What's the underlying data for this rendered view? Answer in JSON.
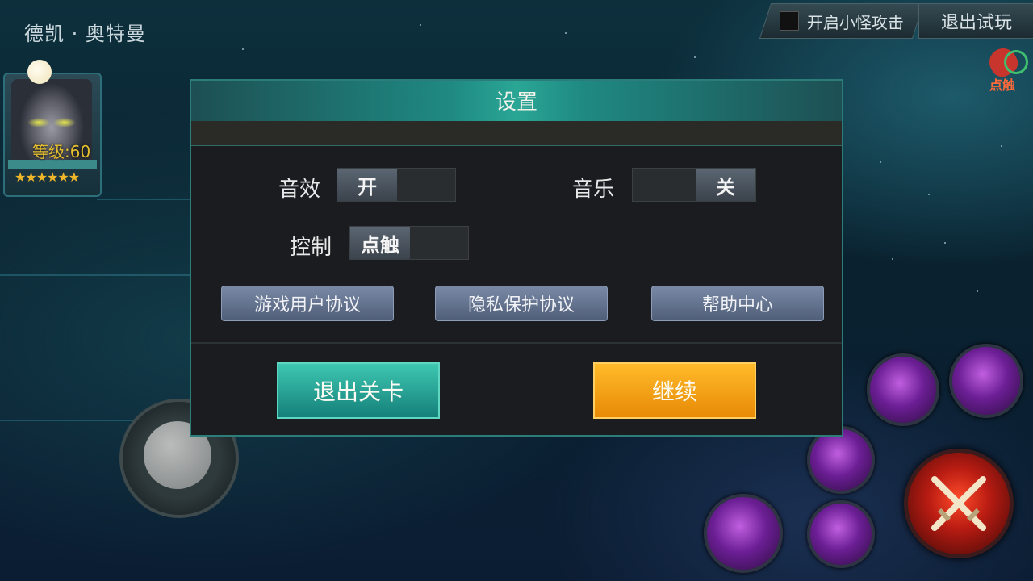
{
  "hud": {
    "player_name": "德凯 · 奥特曼",
    "level_text": "等级:60",
    "stars": "★★★★★★",
    "monster_attack_label": "开启小怪攻击",
    "exit_trial_label": "退出试玩",
    "tap_label": "点触"
  },
  "settings_dialog": {
    "title": "设置",
    "sound_effects": {
      "label": "音效",
      "value": "开"
    },
    "music": {
      "label": "音乐",
      "value": "关"
    },
    "control": {
      "label": "控制",
      "value": "点触"
    },
    "links": [
      "游戏用户协议",
      "隐私保护协议",
      "帮助中心"
    ],
    "exit_level_label": "退出关卡",
    "continue_label": "继续"
  }
}
